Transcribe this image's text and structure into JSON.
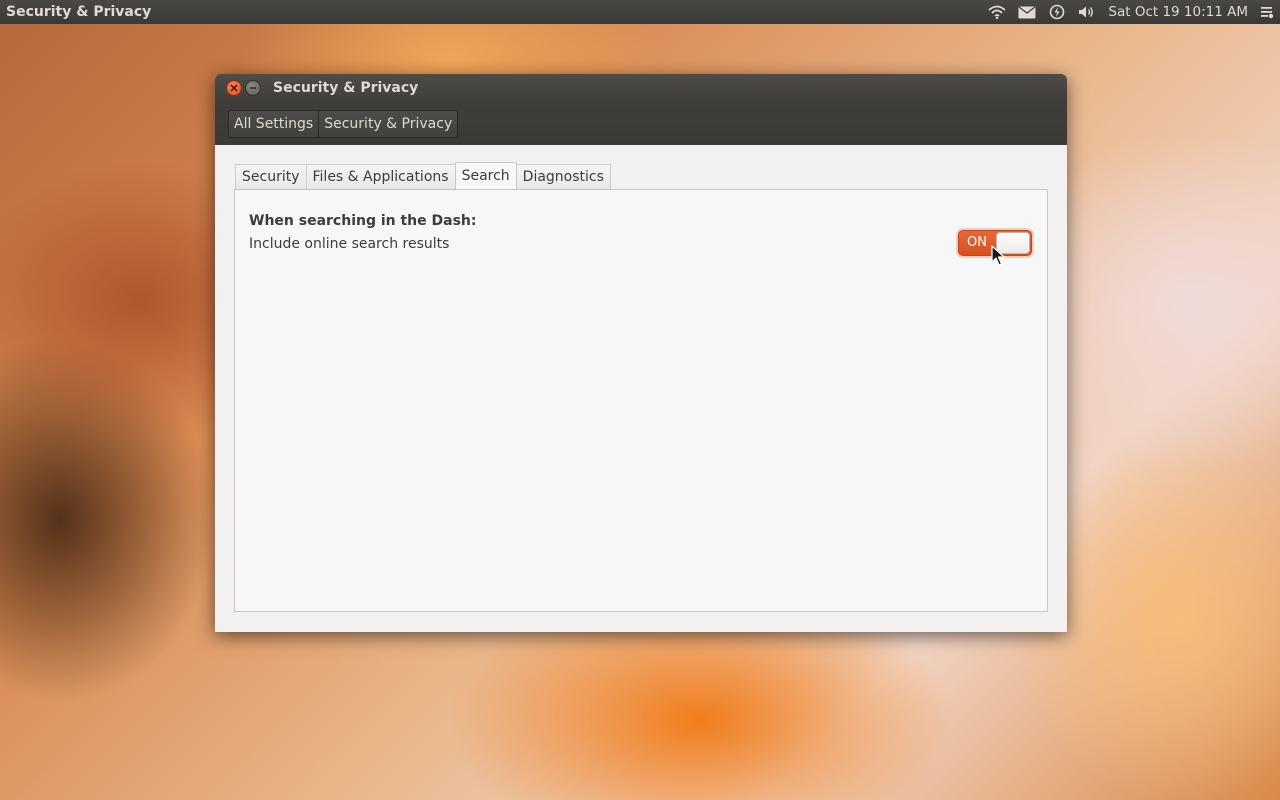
{
  "panel": {
    "app_title": "Security & Privacy",
    "clock": "Sat Oct 19  10:11 AM",
    "indicators": [
      "wifi-icon",
      "mail-icon",
      "power-icon",
      "volume-icon",
      "session-menu-icon"
    ]
  },
  "window": {
    "title": "Security & Privacy",
    "breadcrumbs": [
      "All Settings",
      "Security & Privacy"
    ]
  },
  "tabs": [
    {
      "label": "Security",
      "active": false
    },
    {
      "label": "Files & Applications",
      "active": false
    },
    {
      "label": "Search",
      "active": true
    },
    {
      "label": "Diagnostics",
      "active": false
    }
  ],
  "search_page": {
    "heading": "When searching in the Dash:",
    "option_label": "Include online search results",
    "switch_state": "ON"
  },
  "colors": {
    "accent": "#dd5a27",
    "panel_bg": "#3c3b37",
    "window_bg": "#f2f1f0"
  }
}
